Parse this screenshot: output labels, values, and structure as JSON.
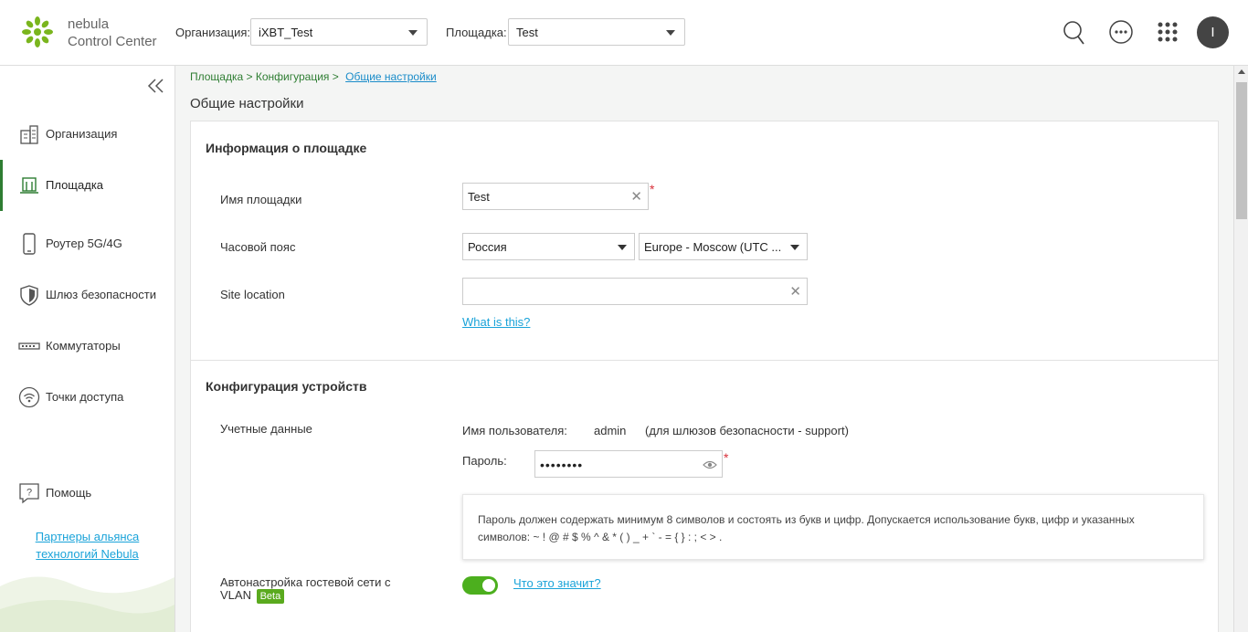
{
  "brand": {
    "line1": "nebula",
    "line2": "Control Center"
  },
  "header": {
    "org_label": "Организация:",
    "org_value": "iXBT_Test",
    "site_label": "Площадка:",
    "site_value": "Test",
    "icons": [
      "search-icon",
      "more-icon",
      "apps-grid-icon"
    ],
    "avatar_letter": "I"
  },
  "sidebar": {
    "items": [
      {
        "label": "Организация",
        "icon": "building-icon"
      },
      {
        "label": "Площадка",
        "icon": "site-icon",
        "active": true
      },
      {
        "label": "Роутер 5G/4G",
        "icon": "phone-icon"
      },
      {
        "label": "Шлюз безопасности",
        "icon": "shield-icon"
      },
      {
        "label": "Коммутаторы",
        "icon": "switch-icon"
      },
      {
        "label": "Точки доступа",
        "icon": "wifi-icon"
      }
    ],
    "help_label": "Помощь",
    "partners_line1": "Партнеры альянса",
    "partners_line2": "технологий Nebula"
  },
  "breadcrumb": {
    "item1": "Площадка",
    "sep": ">",
    "item2": "Конфигурация",
    "current": "Общие настройки"
  },
  "page_title": "Общие настройки",
  "site_info": {
    "title": "Информация о площадке",
    "name_label": "Имя площадки",
    "name_value": "Test",
    "tz_label": "Часовой пояс",
    "tz_country": "Россия",
    "tz_zone": "Europe - Moscow (UTC ...",
    "location_label": "Site location",
    "location_value": "",
    "what_is_this": "What is this?"
  },
  "device_config": {
    "title": "Конфигурация устройств",
    "credentials_label": "Учетные данные",
    "username_label": "Имя пользователя:",
    "username_value": "admin",
    "username_note": "(для шлюзов безопасности - support)",
    "password_label": "Пароль:",
    "password_value": "••••••••",
    "hint": "Пароль должен содержать минимум 8 символов и состоять из букв и цифр. Допускается использование букв, цифр и указанных символов: ~ ! @ # $ % ^ & * ( ) _ + ` - = { } : ; < > .",
    "guest_vlan_label": "Автонастройка гостевой сети с VLAN",
    "beta": "Beta",
    "guest_vlan_on": true,
    "what_means": "Что это значит?"
  },
  "colors": {
    "accent_green": "#4caf1e",
    "link_blue": "#1aa3d9",
    "required_red": "#d9303a"
  }
}
